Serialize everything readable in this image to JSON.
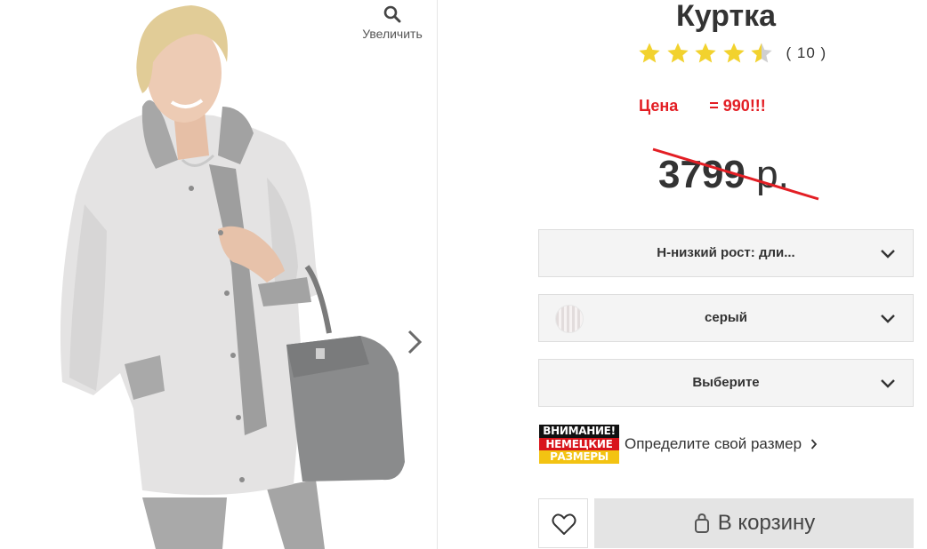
{
  "gallery": {
    "zoom_label": "Увеличить",
    "zoom_icon": "search-icon",
    "next_icon": "chevron-right-icon"
  },
  "product": {
    "title": "Куртка",
    "rating": 4,
    "rating_max": 5,
    "review_count": "( 10 )",
    "promo_text": "Цена       = 990!!!",
    "old_price_value": "3799",
    "old_price_currency": " р."
  },
  "selects": [
    {
      "label": "Н-низкий рост: дли..."
    },
    {
      "label": "серый"
    },
    {
      "label": "Выберите"
    }
  ],
  "size_guide": {
    "badge_lines": [
      "ВНИМАНИЕ!",
      "НЕМЕЦКИЕ",
      "РАЗМЕРЫ"
    ],
    "link_label": "Определите свой размер"
  },
  "actions": {
    "cart_label": "В корзину",
    "favorite_icon": "heart-icon"
  },
  "colors": {
    "promo": "#e31e24",
    "star_filled": "#f2d22e",
    "star_empty": "#cfcfcf",
    "button_bg": "#e4e4e4"
  }
}
